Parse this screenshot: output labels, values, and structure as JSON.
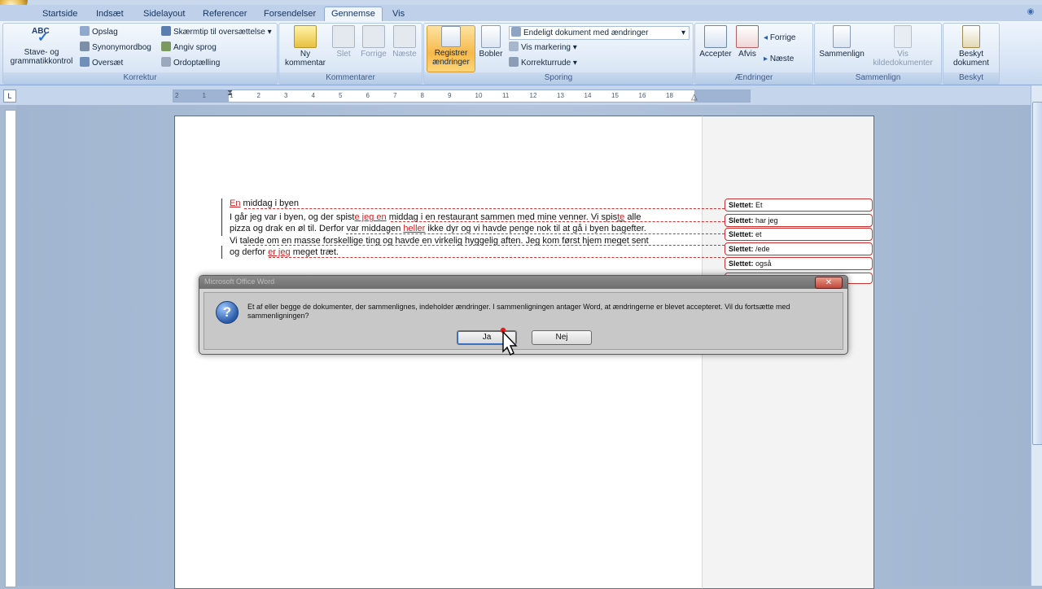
{
  "tabs": [
    {
      "label": "Startside"
    },
    {
      "label": "Indsæt"
    },
    {
      "label": "Sidelayout"
    },
    {
      "label": "Referencer"
    },
    {
      "label": "Forsendelser"
    },
    {
      "label": "Gennemse"
    },
    {
      "label": "Vis"
    }
  ],
  "active_tab": "Gennemse",
  "ribbon": {
    "korrektur": {
      "label": "Korrektur",
      "stave_line1": "Stave- og",
      "stave_line2": "grammatikkontrol",
      "abc": "ABC",
      "opslag": "Opslag",
      "synonym": "Synonymordbog",
      "oversaet": "Oversæt",
      "skaermtip": "Skærmtip til oversættelse",
      "angiv_sprog": "Angiv sprog",
      "ordoptaelling": "Ordoptælling"
    },
    "kommentarer": {
      "label": "Kommentarer",
      "ny_line1": "Ny",
      "ny_line2": "kommentar",
      "slet": "Slet",
      "forrige": "Forrige",
      "naeste": "Næste"
    },
    "sporing": {
      "label": "Sporing",
      "registrer_line1": "Registrer",
      "registrer_line2": "ændringer",
      "bobler": "Bobler",
      "display_select": "Endeligt dokument med ændringer",
      "vis_markering": "Vis markering",
      "korrekturrude": "Korrekturrude"
    },
    "aendringer": {
      "label": "Ændringer",
      "accepter": "Accepter",
      "afvis": "Afvis",
      "forrige": "Forrige",
      "naeste": "Næste"
    },
    "sammenlign": {
      "label": "Sammenlign",
      "sammenlign": "Sammenlign",
      "vis_line1": "Vis",
      "vis_line2": "kildedokumenter"
    },
    "beskyt": {
      "label": "Beskyt",
      "line1": "Beskyt",
      "line2": "dokument"
    }
  },
  "ruler": {
    "corner": "L",
    "ticks": [
      "2",
      "1",
      "1",
      "2",
      "3",
      "4",
      "5",
      "6",
      "7",
      "8",
      "9",
      "10",
      "11",
      "12",
      "13",
      "14",
      "15",
      "16",
      "18"
    ]
  },
  "document": {
    "title_ins": "En",
    "title_rest": "middag i byen",
    "p1_l1_a": "I går jeg var i byen, og der spist",
    "p1_l1_ins1": "e jeg en",
    "p1_l1_b": "middag i en restaurant sammen med mine venner. Vi spis",
    "p1_l1_ins2": "te",
    "p1_l1_c": "alle",
    "p1_l2_a": "pizza og drak en øl til. Derfor var middagen",
    "p1_l2_ins": "heller",
    "p1_l2_b": "ikke dyr og vi havde penge nok til at gå i byen bagefter.",
    "p2_l1": "Vi talede om en masse forskellige ting og havde en virkelig hyggelig aften. Jeg kom først hjem meget sent",
    "p2_l2_a": "og derfor",
    "p2_l2_ins": "er jeg",
    "p2_l2_b": "meget træt."
  },
  "balloons": [
    {
      "label": "Slettet:",
      "text": "Et"
    },
    {
      "label": "Slettet:",
      "text": "har jeg"
    },
    {
      "label": "Slettet:",
      "text": "et"
    },
    {
      "label": "Slettet:",
      "text": "/ede"
    },
    {
      "label": "Slettet:",
      "text": "også"
    }
  ],
  "dialog": {
    "title": "Microsoft Office Word",
    "message": "Et af eller begge de dokumenter, der sammenlignes, indeholder ændringer. I sammenligningen antager Word, at ændringerne er blevet accepteret. Vil du fortsætte med sammenligningen?",
    "yes": "Ja",
    "no": "Nej",
    "icon": "question-icon"
  },
  "colors": {
    "tracked_change": "#d02020",
    "ribbon_highlight": "#f7b94a",
    "page_background": "#a7bad2"
  }
}
